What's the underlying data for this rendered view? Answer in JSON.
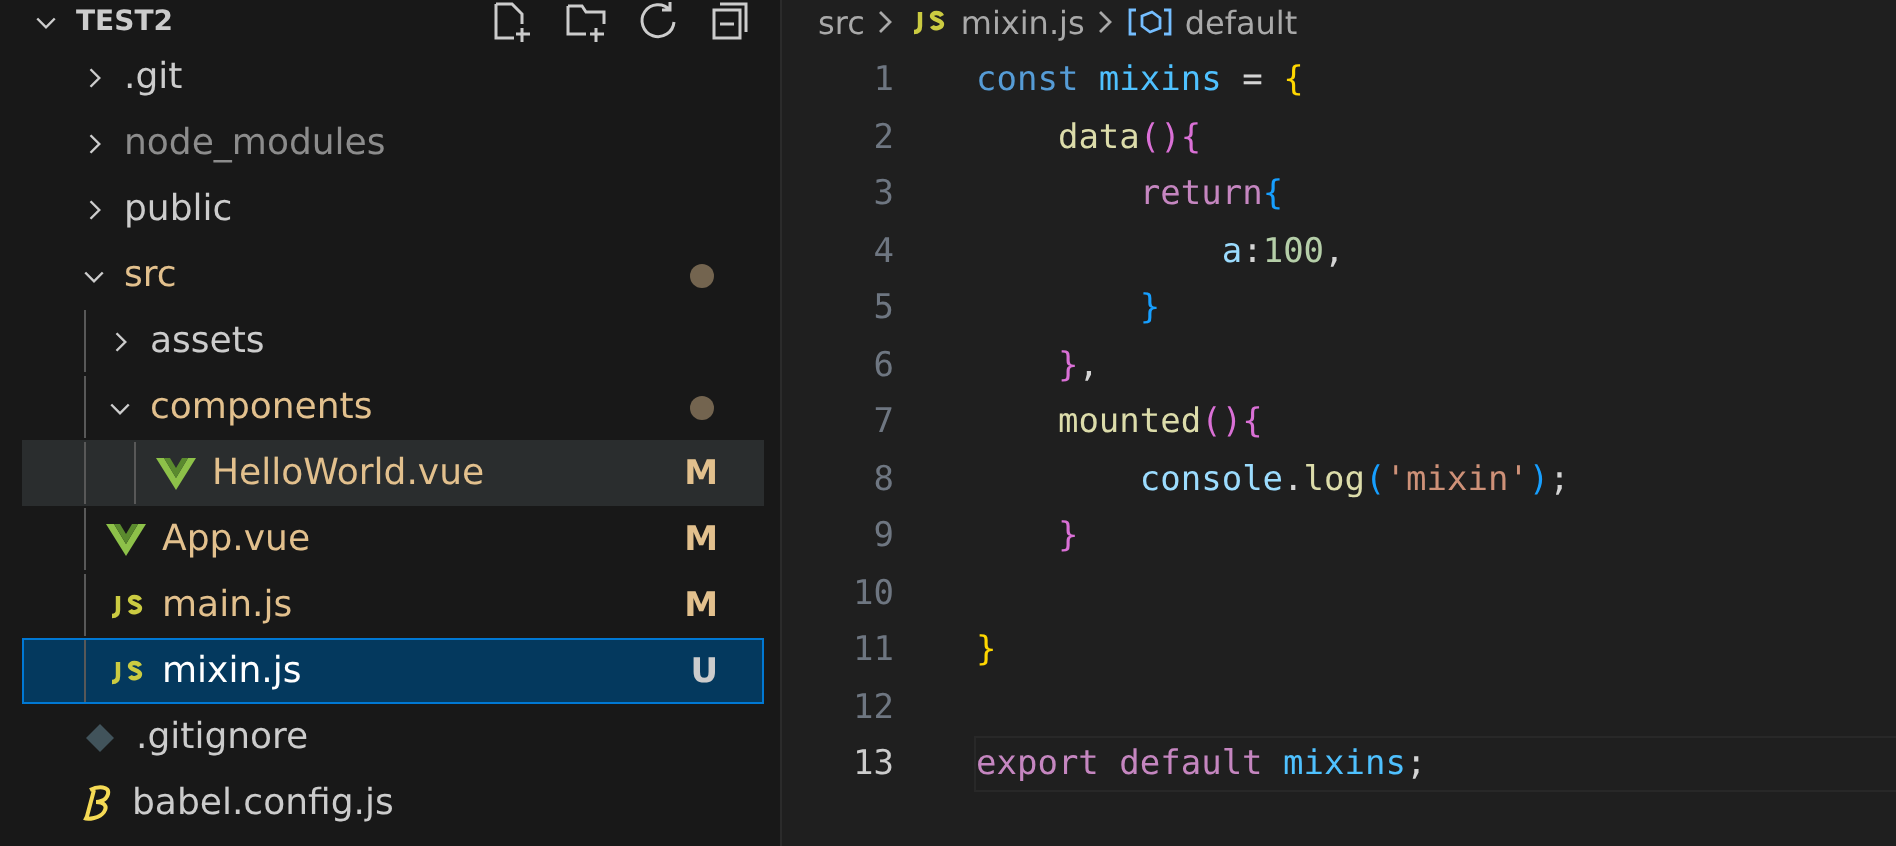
{
  "explorer": {
    "title": "TEST2",
    "expanded": true,
    "items": [
      {
        "label": ".git",
        "kind": "folder",
        "expanded": false,
        "selected": false,
        "hovered": false
      },
      {
        "label": "node_modules",
        "kind": "folder",
        "expanded": false,
        "color": "#8c8c8c",
        "selected": false,
        "hovered": false
      },
      {
        "label": "public",
        "kind": "folder",
        "expanded": false,
        "selected": false,
        "hovered": false
      },
      {
        "label": "src",
        "kind": "folder",
        "expanded": true,
        "color": "#e2c08d",
        "dot": true,
        "selected": false,
        "hovered": false,
        "children": [
          {
            "label": "assets",
            "kind": "folder",
            "expanded": false,
            "selected": false,
            "hovered": false
          },
          {
            "label": "components",
            "kind": "folder",
            "expanded": true,
            "color": "#e2c08d",
            "dot": true,
            "selected": false,
            "hovered": false,
            "children": [
              {
                "label": "HelloWorld.vue",
                "kind": "vue",
                "color": "#e2c08d",
                "status": "M",
                "selected": false,
                "hovered": true
              }
            ]
          },
          {
            "label": "App.vue",
            "kind": "vue",
            "color": "#e2c08d",
            "status": "M",
            "selected": false,
            "hovered": false
          },
          {
            "label": "main.js",
            "kind": "js",
            "color": "#e2c08d",
            "status": "M",
            "selected": false,
            "hovered": false
          },
          {
            "label": "mixin.js",
            "kind": "js",
            "status": "U",
            "selected": true,
            "hovered": false
          }
        ]
      },
      {
        "label": ".gitignore",
        "kind": "git",
        "selected": false,
        "hovered": false
      },
      {
        "label": "babel.config.js",
        "kind": "babel",
        "selected": false,
        "hovered": false
      }
    ]
  },
  "breadcrumb": [
    {
      "label": "src",
      "kind": "folder"
    },
    {
      "label": "mixin.js",
      "kind": "js"
    },
    {
      "label": "default",
      "kind": "symbol"
    }
  ],
  "code": [
    {
      "number": "1",
      "current": false,
      "tokens": [
        {
          "text": "const ",
          "kind": "storage"
        },
        {
          "text": "mixins",
          "kind": "const"
        },
        {
          "text": " = ",
          "kind": "punct"
        },
        {
          "text": "{",
          "kind": "b1"
        }
      ]
    },
    {
      "number": "2",
      "current": false,
      "tokens": [
        {
          "text": "    data",
          "kind": "func"
        },
        {
          "text": "(){",
          "kind": "b2"
        }
      ]
    },
    {
      "number": "3",
      "current": false,
      "tokens": [
        {
          "text": "        return",
          "kind": "control"
        },
        {
          "text": "{",
          "kind": "b3"
        }
      ]
    },
    {
      "number": "4",
      "current": false,
      "tokens": [
        {
          "text": "            a",
          "kind": "prop"
        },
        {
          "text": ":",
          "kind": "punct"
        },
        {
          "text": "100",
          "kind": "num"
        },
        {
          "text": ",",
          "kind": "punct"
        }
      ]
    },
    {
      "number": "5",
      "current": false,
      "tokens": [
        {
          "text": "        }",
          "kind": "b3"
        }
      ]
    },
    {
      "number": "6",
      "current": false,
      "tokens": [
        {
          "text": "    }",
          "kind": "b2"
        },
        {
          "text": ",",
          "kind": "punct"
        }
      ]
    },
    {
      "number": "7",
      "current": false,
      "tokens": [
        {
          "text": "    mounted",
          "kind": "func"
        },
        {
          "text": "(){",
          "kind": "b2"
        }
      ]
    },
    {
      "number": "8",
      "current": false,
      "tokens": [
        {
          "text": "        console",
          "kind": "prop"
        },
        {
          "text": ".",
          "kind": "punct"
        },
        {
          "text": "log",
          "kind": "func"
        },
        {
          "text": "(",
          "kind": "b3"
        },
        {
          "text": "'mixin'",
          "kind": "str"
        },
        {
          "text": ")",
          "kind": "b3"
        },
        {
          "text": ";",
          "kind": "punct"
        }
      ]
    },
    {
      "number": "9",
      "current": false,
      "tokens": [
        {
          "text": "    }",
          "kind": "b2"
        }
      ]
    },
    {
      "number": "10",
      "current": false
    },
    {
      "number": "11",
      "current": false,
      "tokens": [
        {
          "text": "}",
          "kind": "b1"
        }
      ]
    },
    {
      "number": "12",
      "current": false
    },
    {
      "number": "13",
      "current": true,
      "tokens": [
        {
          "text": "export default ",
          "kind": "control"
        },
        {
          "text": "mixins",
          "kind": "const"
        },
        {
          "text": ";",
          "kind": "punct"
        }
      ]
    }
  ]
}
